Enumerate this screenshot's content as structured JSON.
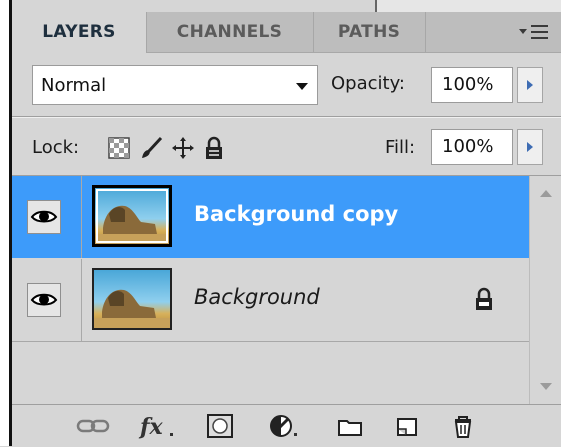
{
  "tabs": [
    {
      "label": "LAYERS",
      "active": true
    },
    {
      "label": "CHANNELS",
      "active": false
    },
    {
      "label": "PATHS",
      "active": false
    }
  ],
  "panel_menu_icon": "panel-menu-icon",
  "blend_mode": {
    "selected": "Normal"
  },
  "opacity": {
    "label": "Opacity:",
    "value": "100%"
  },
  "lock": {
    "label": "Lock:",
    "icons": [
      "lock-transparent-pixels-icon",
      "lock-image-pixels-icon",
      "lock-position-icon",
      "lock-all-icon"
    ]
  },
  "fill": {
    "label": "Fill:",
    "value": "100%"
  },
  "layers": [
    {
      "name": "Background copy",
      "selected": true,
      "visible": true,
      "locked": false
    },
    {
      "name": "Background",
      "selected": false,
      "visible": true,
      "locked": true
    }
  ],
  "toolbar_icons": [
    "link-layers-icon",
    "fx-icon",
    "layer-mask-icon",
    "adjustment-layer-icon",
    "group-folder-icon",
    "new-layer-icon",
    "delete-layer-icon"
  ],
  "colors": {
    "selected_layer": "#3d9bfa",
    "panel_bg": "#d6d6d6",
    "accent_arrow": "#3d6cb3"
  }
}
